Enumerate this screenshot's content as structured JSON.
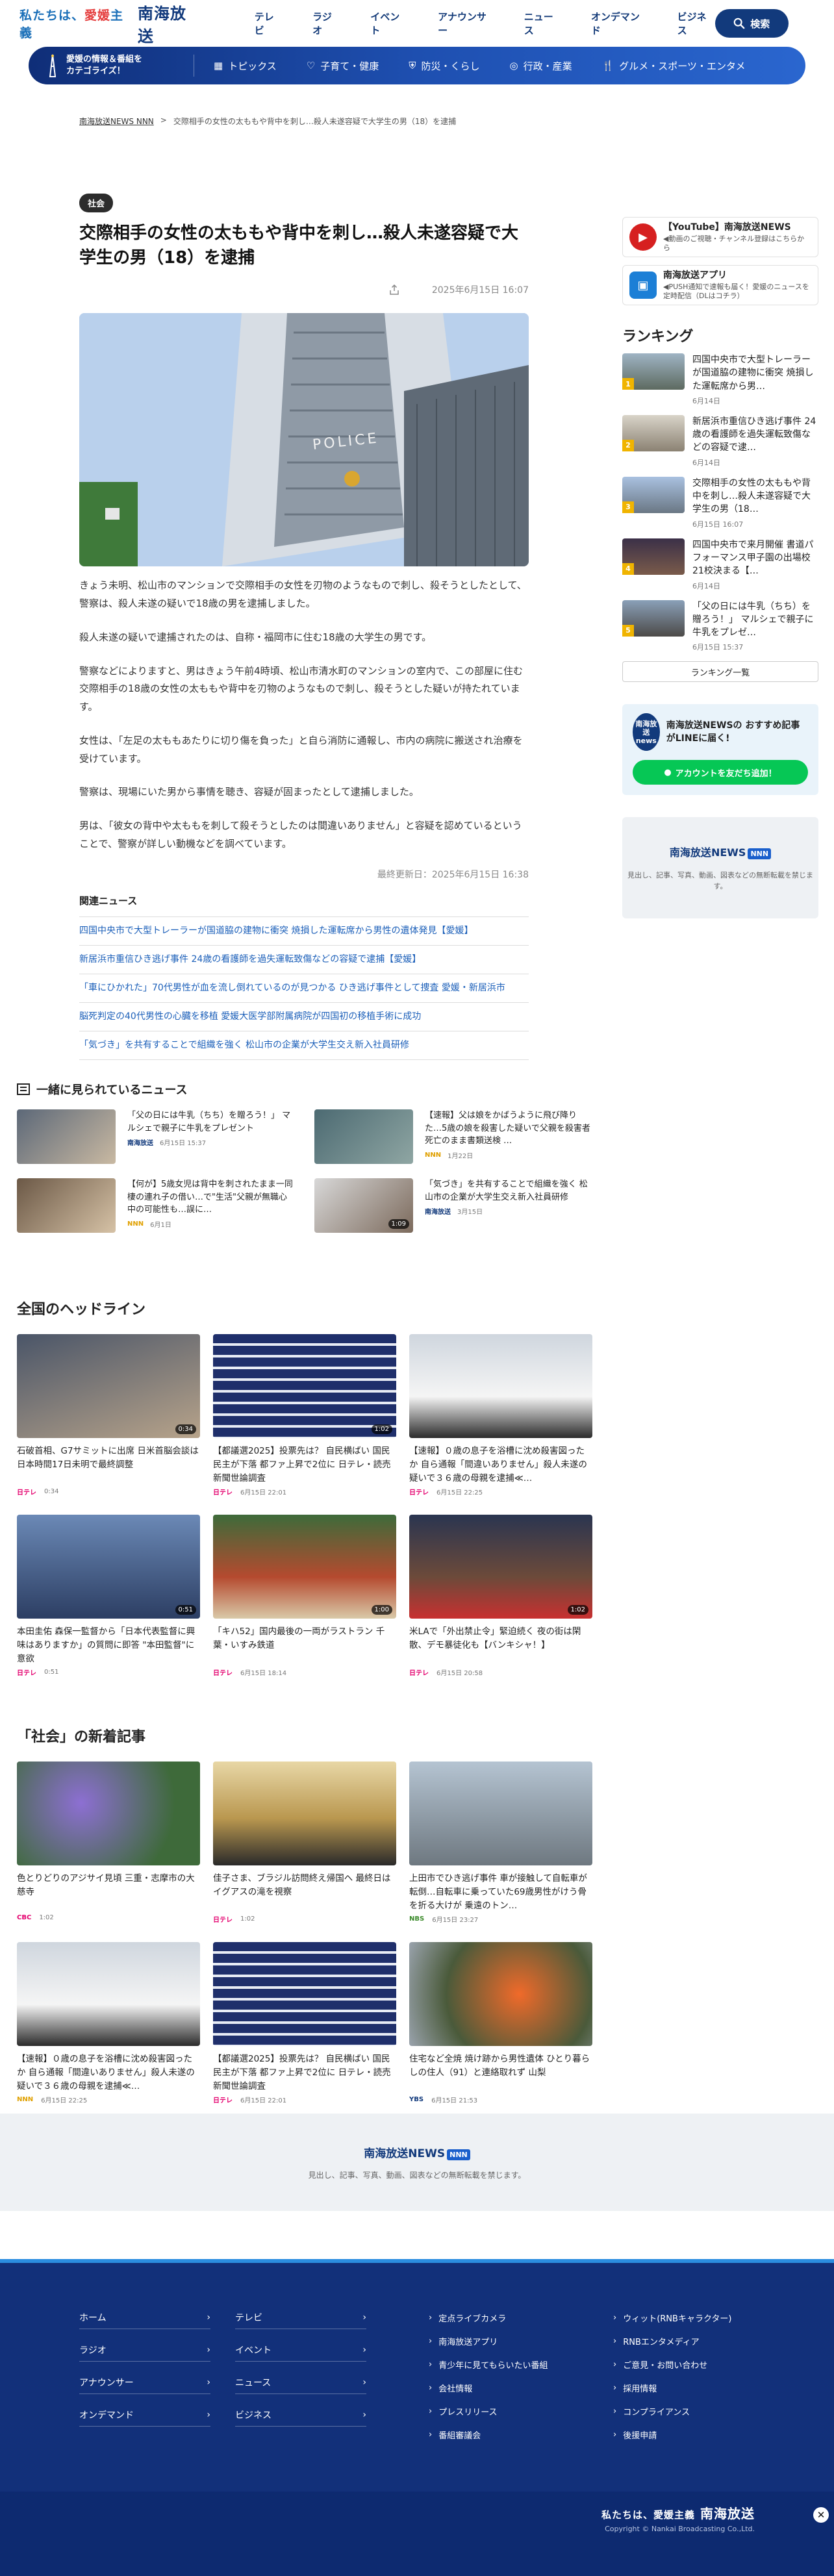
{
  "header": {
    "tagline_pre": "私たちは、",
    "tagline_mid": "愛媛",
    "tagline_post": "主義",
    "brand": "南海放送",
    "nav": [
      "テレビ",
      "ラジオ",
      "イベント",
      "アナウンサー",
      "ニュース",
      "オンデマンド",
      "ビジネス"
    ],
    "search_label": "検索"
  },
  "catbar": {
    "left_line1": "愛媛の情報＆番組を",
    "left_line2": "カテゴライズ！",
    "items": [
      "トピックス",
      "子育て・健康",
      "防災・くらし",
      "行政・産業",
      "グルメ・スポーツ・エンタメ"
    ]
  },
  "breadcrumb": {
    "home": "南海放送NEWS NNN",
    "sep": ">",
    "current": "交際相手の女性の太ももや背中を刺し…殺人未遂容疑で大学生の男（18）を逮捕"
  },
  "article": {
    "badge": "社会",
    "title": "交際相手の女性の太ももや背中を刺し…殺人未遂容疑で大学生の男（18）を逮捕",
    "date": "2025年6月15日 16:07",
    "hero_sign": "POLICE",
    "paragraphs": [
      "きょう未明、松山市のマンションで交際相手の女性を刃物のようなもので刺し、殺そうとしたとして、警察は、殺人未遂の疑いで18歳の男を逮捕しました。",
      "殺人未遂の疑いで逮捕されたのは、自称・福岡市に住む18歳の大学生の男です。",
      "警察などによりますと、男はきょう午前4時頃、松山市清水町のマンションの室内で、この部屋に住む交際相手の18歳の女性の太ももや背中を刃物のようなもので刺し、殺そうとした疑いが持たれています。",
      "女性は、「左足の太ももあたりに切り傷を負った」と自ら消防に通報し、市内の病院に搬送され治療を受けています。",
      "警察は、現場にいた男から事情を聴き、容疑が固まったとして逮捕しました。",
      "男は、「彼女の背中や太ももを刺して殺そうとしたのは間違いありません」と容疑を認めているということで、警察が詳しい動機などを調べています。"
    ],
    "updated": "最終更新日：2025年6月15日 16:38",
    "related_title": "関連ニュース",
    "related": [
      "四国中央市で大型トレーラーが国道脇の建物に衝突 焼損した運転席から男性の遺体発見【愛媛】",
      "新居浜市重信ひき逃げ事件 24歳の看護師を過失運転致傷などの容疑で逮捕【愛媛】",
      "「車にひかれた」70代男性が血を流し倒れているのが見つかる ひき逃げ事件として捜査 愛媛・新居浜市",
      "脳死判定の40代男性の心臓を移植 愛媛大医学部附属病院が四国初の移植手術に成功",
      "「気づき」を共有することで組織を強く 松山市の企業が大学生交え新入社員研修"
    ]
  },
  "sidebar": {
    "promos": [
      {
        "title": "【YouTube】南海放送NEWS",
        "sub": "◀動画のご視聴・チャンネル登録はこちらから"
      },
      {
        "title": "南海放送アプリ",
        "sub": "◀PUSH通知で速報も届く！愛媛のニュースを定時配信（DLはコチラ）"
      }
    ],
    "ranking_title": "ランキング",
    "ranking": [
      {
        "title": "四国中央市で大型トレーラーが国道脇の建物に衝突 焼損した運転席から男…",
        "date": "6月14日"
      },
      {
        "title": "新居浜市重信ひき逃げ事件 24歳の看護師を過失運転致傷などの容疑で逮…",
        "date": "6月14日"
      },
      {
        "title": "交際相手の女性の太ももや背中を刺し…殺人未遂容疑で大学生の男（18…",
        "date": "6月15日 16:07"
      },
      {
        "title": "四国中央市で来月開催 書道パフォーマンス甲子園の出場校21校決まる【…",
        "date": "6月14日"
      },
      {
        "title": "「父の日には牛乳（ちち）を贈ろう！」 マルシェで親子に牛乳をプレゼ…",
        "date": "6月15日 15:37"
      }
    ],
    "ranking_more": "ランキング一覧",
    "line_icon_text": "南海放送 news",
    "line_title": "南海放送NEWSの おすすめ記事がLINEに届く!",
    "line_button": "アカウントを友だち追加！",
    "news_logo": "南海放送",
    "news_logo_word": "NEWS",
    "news_logo_badge": "NNN",
    "news_sub": "見出し、記事、写真、動画、図表などの無断転載を禁じます。"
  },
  "together": {
    "title": "一緒に見られているニュース",
    "items": [
      {
        "title": "「父の日には牛乳（ちち）を贈ろう！」 マルシェで親子に牛乳をプレゼント",
        "source": "南海放送",
        "date": "6月15日 15:37"
      },
      {
        "title": "【速報】父は娘をかばうように飛び降りた…5歳の娘を殺害した疑いで父親を殺害者死亡のまま書類送検 …",
        "source": "NNN",
        "date": "1月22日"
      },
      {
        "title": "【何が】5歳女児は背中を刺されたまま一同棲の連れ子の借い…で\"生活\"父親が無職心中の可能性も…誤に…",
        "source": "NNN",
        "date": "6月1日"
      },
      {
        "title": "「気づき」を共有することで組織を強く 松山市の企業が大学生交え新入社員研修",
        "source": "南海放送",
        "date": "3月15日",
        "duration": "1:09"
      }
    ]
  },
  "national": {
    "title": "全国のヘッドライン",
    "cards": [
      {
        "title": "石破首相、G7サミットに出席 日米首脳会談は日本時間17日未明で最終調整",
        "source": "日テレ",
        "date": "0:34",
        "duration": "0:34"
      },
      {
        "title": "【都議選2025】投票先は？ 自民横ばい 国民民主が下落 都ファ上昇で2位に 日テレ・読売新聞世論調査",
        "source": "日テレ",
        "date": "6月15日 22:01",
        "duration": "1:02"
      },
      {
        "title": "【速報】０歳の息子を浴槽に沈め殺害図ったか 自ら通報「間違いありません」殺人未遂の疑いで３６歳の母親を逮捕≪…",
        "source": "日テレ",
        "date": "6月15日 22:25"
      },
      {
        "title": "本田圭佑 森保一監督から「日本代表監督に興味はありますか」の質問に即答 \"本田監督\"に意欲",
        "source": "日テレ",
        "date": "0:51",
        "duration": "0:51"
      },
      {
        "title": "「キハ52」国内最後の一両がラストラン 千葉・いすみ鉄道",
        "source": "日テレ",
        "date": "6月15日 18:14",
        "duration": "1:00"
      },
      {
        "title": "米LAで「外出禁止令」緊迫続く 夜の街は閑散、デモ暴徒化も【バンキシャ！】",
        "source": "日テレ",
        "date": "6月15日 20:58",
        "duration": "1:02"
      }
    ]
  },
  "social": {
    "title": "「社会」の新着記事",
    "cards": [
      {
        "title": "色とりどりのアジサイ見頃 三重・志摩市の大慈寺",
        "source": "CBC",
        "date": "1:02"
      },
      {
        "title": "佳子さま、ブラジル訪問終え帰国へ 最終日はイグアスの滝を視察",
        "source": "日テレ",
        "date": "1:02"
      },
      {
        "title": "上田市でひき逃げ事件 車が接触して自転車が転倒…自転車に乗っていた69歳男性がけう骨を折る大けが 乗遠のトン…",
        "source": "NBS",
        "date": "6月15日 23:27"
      },
      {
        "title": "【速報】０歳の息子を浴槽に沈め殺害図ったか 自ら通報「間違いありません」殺人未遂の疑いで３６歳の母親を逮捕≪…",
        "source": "NNN",
        "date": "6月15日 22:25"
      },
      {
        "title": "【都議選2025】投票先は？ 自民横ばい 国民民主が下落 都ファ上昇で2位に 日テレ・読売新聞世論調査",
        "source": "日テレ",
        "date": "6月15日 22:01"
      },
      {
        "title": "住宅など全焼 焼け跡から男性遺体 ひとり暮らしの住人（91）と連絡取れず 山梨",
        "source": "YBS",
        "date": "6月15日 21:53"
      }
    ]
  },
  "bottom_news": {
    "logo": "南海放送",
    "word": "NEWS",
    "badge": "NNN",
    "sub": "見出し、記事、写真、動画、図表などの無断転載を禁じます。"
  },
  "footer": {
    "col1": [
      "ホーム",
      "ラジオ",
      "アナウンサー",
      "オンデマンド"
    ],
    "col2": [
      "テレビ",
      "イベント",
      "ニュース",
      "ビジネス"
    ],
    "links": [
      "定点ライブカメラ",
      "ウィット(RNBキャラクター)",
      "南海放送アプリ",
      "RNBエンタメディア",
      "青少年に見てもらいたい番組",
      "ご意見・お問い合わせ",
      "会社情報",
      "採用情報",
      "プレスリリース",
      "コンプライアンス",
      "番組審議会",
      "後援申請"
    ],
    "brand_pre": "私たちは、愛媛主義",
    "brand": "南海放送",
    "copyright": "Copyright © Nankai Broadcasting Co.,Ltd."
  },
  "colors": {
    "brand_navy": "#123a7c",
    "link_blue": "#1b5fb9",
    "line_green": "#06c755",
    "footer_bg": "#12307a"
  }
}
